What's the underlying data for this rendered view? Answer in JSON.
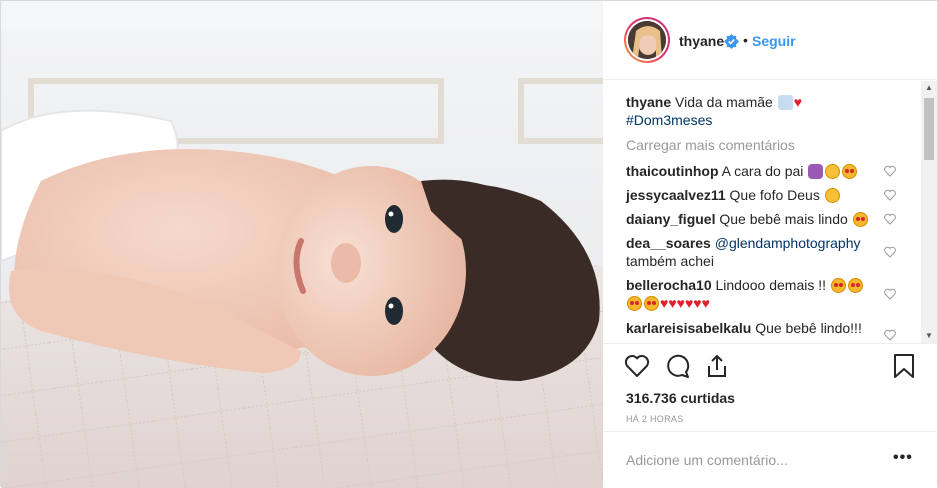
{
  "post": {
    "username": "thyane",
    "follow_label": "Seguir",
    "separator": "•"
  },
  "caption": {
    "username": "thyane",
    "text": "Vida da mamãe",
    "hashtag": "#Dom3meses"
  },
  "load_more_label": "Carregar mais comentários",
  "comments": [
    {
      "user": "thaicoutinhop",
      "text": "A cara do pai"
    },
    {
      "user": "jessycaalvez11",
      "text": "Que fofo Deus"
    },
    {
      "user": "daiany_figuel",
      "text": "Que bebê mais lindo"
    },
    {
      "user": "dea__soares",
      "mention": "@glendamphotography",
      "text": "também achei"
    },
    {
      "user": "bellerocha10",
      "text": "Lindooo demais !!"
    },
    {
      "user": "karlareisisabelkalu",
      "text": "Que bebê lindo!!!"
    }
  ],
  "likes": "316.736 curtidas",
  "time": "HÁ 2 HORAS",
  "add_comment_placeholder": "Adicione um comentário...",
  "more_options": "•••",
  "colors": {
    "link": "#3897f0",
    "hashtag": "#003569",
    "muted": "#999999",
    "verified": "#3897f0"
  },
  "icons": [
    "verified-badge-icon",
    "heart-icon",
    "comment-icon",
    "share-icon",
    "bookmark-icon",
    "more-options-icon"
  ]
}
